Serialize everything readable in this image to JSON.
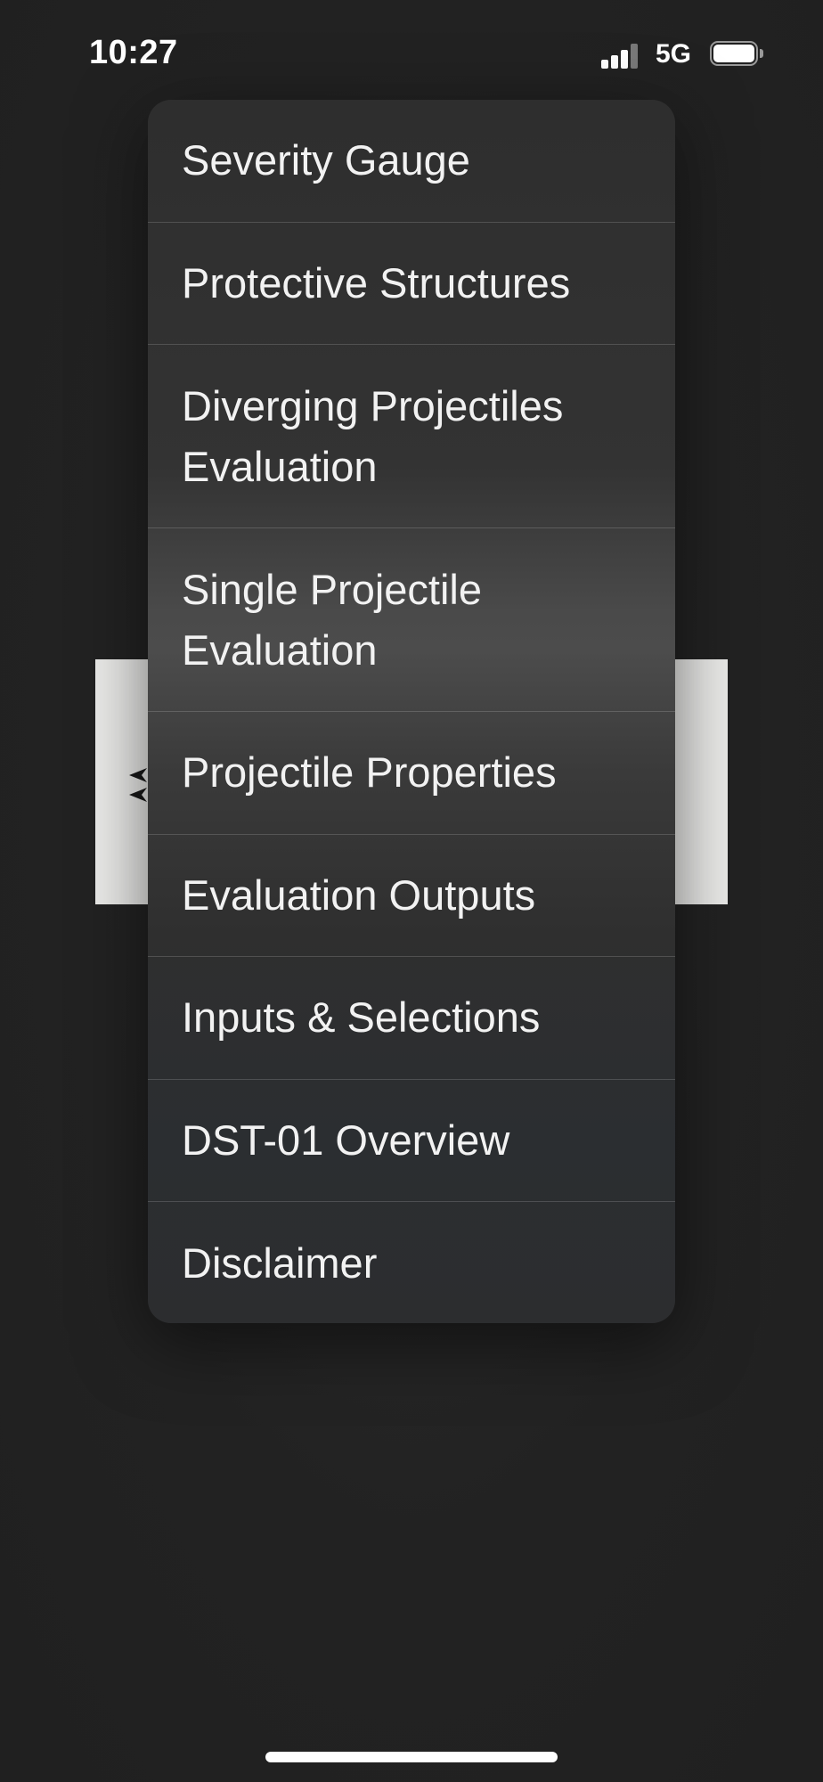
{
  "status_bar": {
    "time": "10:27",
    "network": "5G",
    "signal_icon": "cellular-signal-icon",
    "battery_icon": "battery-full-icon"
  },
  "background": {
    "chevron_icon": "chevron-left-icon"
  },
  "menu": {
    "items": [
      {
        "label": "Severity Gauge"
      },
      {
        "label": "Protective Structures"
      },
      {
        "label": "Diverging Projectiles Evaluation"
      },
      {
        "label": "Single Projectile Evaluation"
      },
      {
        "label": "Projectile Properties"
      },
      {
        "label": "Evaluation Outputs"
      },
      {
        "label": "Inputs & Selections"
      },
      {
        "label": "DST-01 Overview"
      },
      {
        "label": "Disclaimer"
      }
    ]
  },
  "colors": {
    "background": "#222222",
    "menu_text": "#f2f2f2",
    "bg_card": "#ececea"
  }
}
